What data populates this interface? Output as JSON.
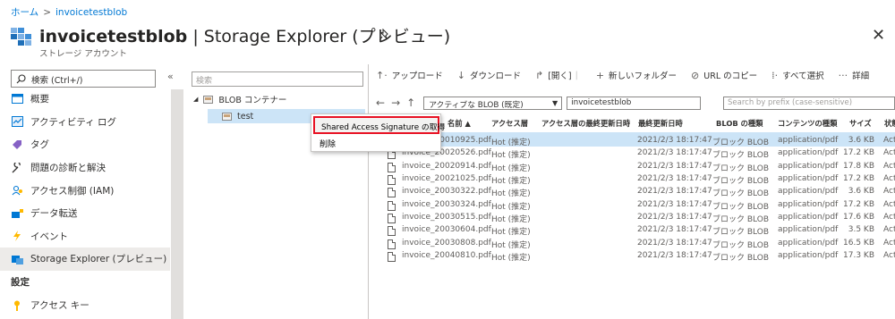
{
  "breadcrumb": {
    "home": "ホーム",
    "current": "invoicetestblob"
  },
  "header": {
    "title_bold": "invoicetestblob",
    "title_rest": " | Storage Explorer (プレビュー)",
    "subtitle": "ストレージ アカウント",
    "icons": {
      "pin": "pin-icon",
      "close": "close-icon"
    }
  },
  "nav": {
    "search_placeholder": "検索 (Ctrl+/)",
    "items": [
      {
        "label": "概要",
        "icon": "overview-icon"
      },
      {
        "label": "アクティビティ ログ",
        "icon": "activity-log-icon"
      },
      {
        "label": "タグ",
        "icon": "tag-icon"
      },
      {
        "label": "問題の診断と解決",
        "icon": "wrench-icon"
      },
      {
        "label": "アクセス制御 (IAM)",
        "icon": "people-icon"
      },
      {
        "label": "データ転送",
        "icon": "data-transfer-icon"
      },
      {
        "label": "イベント",
        "icon": "lightning-icon"
      },
      {
        "label": "Storage Explorer (プレビュー)",
        "icon": "storage-explorer-icon"
      }
    ],
    "section_settings": "設定",
    "settings_items": [
      {
        "label": "アクセス キー",
        "icon": "key-icon"
      }
    ]
  },
  "tree": {
    "search_placeholder": "検索",
    "root_label": "BLOB コンテナー",
    "child_label": "test"
  },
  "context_menu": {
    "sas_label": "Shared Access Signature の取得",
    "delete_label": "削除"
  },
  "toolbar": {
    "upload": "アップロード",
    "download": "ダウンロード",
    "open": "[開く]",
    "new_folder": "新しいフォルダー",
    "copy_url": "URL のコピー",
    "select_all": "すべて選択",
    "details": "詳細"
  },
  "address": {
    "tier_select": "アクティブな BLOB (既定)",
    "path": "invoicetestblob",
    "prefix_placeholder": "Search by prefix (case-sensitive)"
  },
  "table": {
    "headers": {
      "name": "名前",
      "tier": "アクセス層",
      "tier_modified": "アクセス層の最終更新日時",
      "modified": "最終更新日時",
      "blob_type": "BLOB の種類",
      "content_type": "コンテンツの種類",
      "size": "サイズ",
      "status": "状態"
    },
    "rows": [
      {
        "name": "invoice_20010925.pdf",
        "tier": "Hot (推定)",
        "modified": "2021/2/3 18:17:47",
        "blob_type": "ブロック BLOB",
        "content_type": "application/pdf",
        "size": "3.6 KB",
        "status": "Act"
      },
      {
        "name": "invoice_20020526.pdf",
        "tier": "Hot (推定)",
        "modified": "2021/2/3 18:17:47",
        "blob_type": "ブロック BLOB",
        "content_type": "application/pdf",
        "size": "17.2 KB",
        "status": "Act"
      },
      {
        "name": "invoice_20020914.pdf",
        "tier": "Hot (推定)",
        "modified": "2021/2/3 18:17:47",
        "blob_type": "ブロック BLOB",
        "content_type": "application/pdf",
        "size": "17.8 KB",
        "status": "Act"
      },
      {
        "name": "invoice_20021025.pdf",
        "tier": "Hot (推定)",
        "modified": "2021/2/3 18:17:47",
        "blob_type": "ブロック BLOB",
        "content_type": "application/pdf",
        "size": "17.2 KB",
        "status": "Act"
      },
      {
        "name": "invoice_20030322.pdf",
        "tier": "Hot (推定)",
        "modified": "2021/2/3 18:17:47",
        "blob_type": "ブロック BLOB",
        "content_type": "application/pdf",
        "size": "3.6 KB",
        "status": "Act"
      },
      {
        "name": "invoice_20030324.pdf",
        "tier": "Hot (推定)",
        "modified": "2021/2/3 18:17:47",
        "blob_type": "ブロック BLOB",
        "content_type": "application/pdf",
        "size": "17.2 KB",
        "status": "Act"
      },
      {
        "name": "invoice_20030515.pdf",
        "tier": "Hot (推定)",
        "modified": "2021/2/3 18:17:47",
        "blob_type": "ブロック BLOB",
        "content_type": "application/pdf",
        "size": "17.6 KB",
        "status": "Act"
      },
      {
        "name": "invoice_20030604.pdf",
        "tier": "Hot (推定)",
        "modified": "2021/2/3 18:17:47",
        "blob_type": "ブロック BLOB",
        "content_type": "application/pdf",
        "size": "3.5 KB",
        "status": "Act"
      },
      {
        "name": "invoice_20030808.pdf",
        "tier": "Hot (推定)",
        "modified": "2021/2/3 18:17:47",
        "blob_type": "ブロック BLOB",
        "content_type": "application/pdf",
        "size": "16.5 KB",
        "status": "Act"
      },
      {
        "name": "invoice_20040810.pdf",
        "tier": "Hot (推定)",
        "modified": "2021/2/3 18:17:47",
        "blob_type": "ブロック BLOB",
        "content_type": "application/pdf",
        "size": "17.3 KB",
        "status": "Act"
      }
    ]
  },
  "colors": {
    "accent": "#0078d4",
    "selection": "#cce4f7",
    "highlight_border": "#e81123",
    "nav_active": "#edebe9"
  }
}
